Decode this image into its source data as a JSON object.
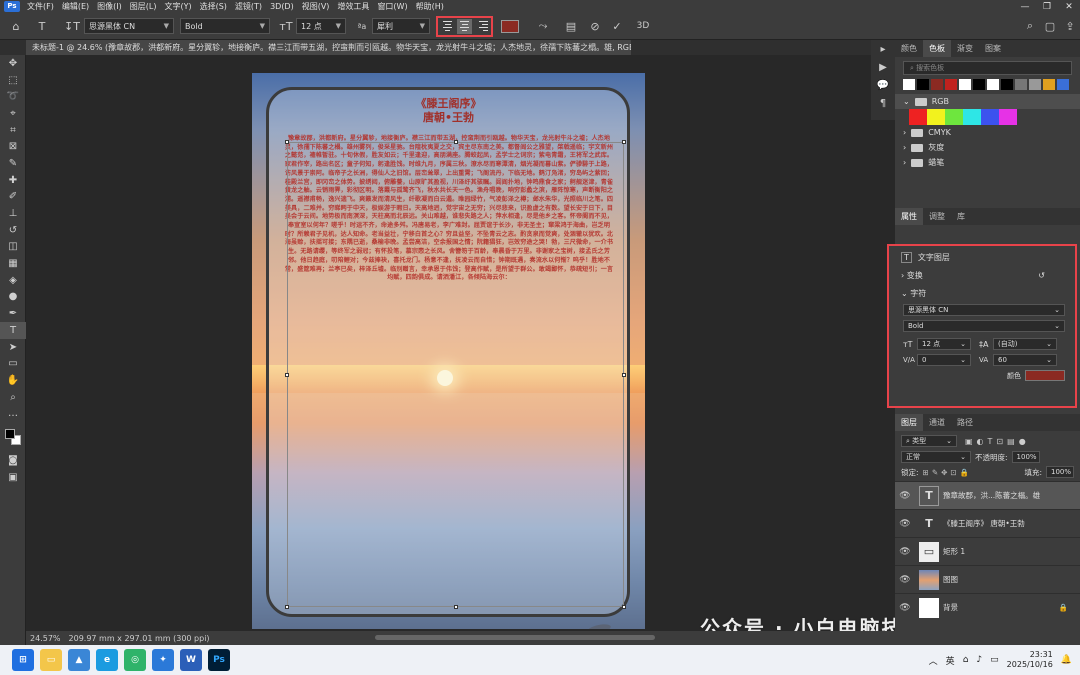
{
  "menu": {
    "items": [
      "文件(F)",
      "编辑(E)",
      "图像(I)",
      "图层(L)",
      "文字(Y)",
      "选择(S)",
      "滤镜(T)",
      "3D(D)",
      "视图(V)",
      "增效工具",
      "窗口(W)",
      "帮助(H)"
    ]
  },
  "options": {
    "font_family": "思源黑体 CN",
    "font_style": "Bold",
    "font_size": "12 点",
    "antialias": "犀利",
    "text_color": "#8b2a22"
  },
  "document": {
    "tab_title": "未标题-1 @ 24.6% (豫章故郡，洪都新府。星分翼轸，地接衡庐。襟三江而带五湖，控蛮荆而引瓯越。物华天宝，龙光射牛斗之墟；人杰地灵，徐孺下陈蕃之榻。雄, RGB/8) *",
    "zoom": "24.57%",
    "size_info": "209.97 mm x 297.01 mm (300 ppi)"
  },
  "poem": {
    "title": "《滕王阁序》",
    "author": "唐朝•王勃",
    "body": "豫章故郡，洪都新府。星分翼轸，地接衡庐。襟三江而带五湖，控蛮荆而引瓯越。物华天宝，龙光射牛斗之墟；人杰地灵，徐孺下陈蕃之榻。雄州雾列，俊采星驰。台隍枕夷夏之交，宾主尽东南之美。都督阎公之雅望，棨戟遥临；宇文新州之懿范，襜帷暂驻。十旬休假，胜友如云；千里逢迎，高朋满座。腾蛟起凤，孟学士之词宗；紫电青霜，王将军之武库。家君作宰，路出名区；童子何知，躬逢胜饯。时维九月，序属三秋。潦水尽而寒潭清，烟光凝而暮山紫。俨骖騑于上路，访风景于崇阿。临帝子之长洲，得仙人之旧馆。层峦耸翠，上出重霄；飞阁流丹，下临无地。鹤汀凫渚，穷岛屿之萦回；桂殿兰宫，即冈峦之体势。披绣闼，俯雕甍，山原旷其盈视，川泽纡其骇瞩。闾阎扑地，钟鸣鼎食之家；舸舰迷津，青雀黄龙之舳。云销雨霁，彩彻区明。落霞与孤鹜齐飞，秋水共长天一色。渔舟唱晚，响穷彭蠡之滨，雁阵惊寒，声断衡阳之浦。遥襟甫畅，逸兴遄飞。爽籁发而清风生，纤歌凝而白云遏。睢园绿竹，气凌彭泽之樽；邺水朱华，光照临川之笔。四美具，二难并。穷睇眄于中天，极娱游于暇日。天高地迥，觉宇宙之无穷；兴尽悲来，识盈虚之有数。望长安于日下，目吴会于云间。地势极而南溟深，天柱高而北辰远。关山难越，谁悲失路之人；萍水相逢，尽是他乡之客。怀帝阍而不见，奉宣室以何年？嗟乎！时运不齐，命途多舛。冯唐易老，李广难封。屈贾谊于长沙，非无圣主；窜梁鸿于海曲，岂乏明时？所赖君子见机，达人知命。老当益壮，宁移白首之心？穷且益坚，不坠青云之志。酌贪泉而觉爽，处涸辙以犹欢。北海虽赊，扶摇可接；东隅已逝，桑榆非晚。孟尝高洁，空余报国之情；阮籍猖狂，岂效穷途之哭！勃，三尺微命，一介书生。无路请缨，等终军之弱冠；有怀投笔，慕宗悫之长风。舍簪笏于百龄，奉晨昏于万里。非谢家之宝树，接孟氏之芳邻。他日趋庭，叨陪鲤对；今兹捧袂，喜托龙门。杨意不逢，抚凌云而自惜；钟期既遇，奏流水以何惭？呜乎！胜地不常，盛筵难再；兰亭已矣，梓泽丘墟。临别赠言，幸承恩于伟饯；登高作赋，是所望于群公。敢竭鄙怀，恭疏短引；一言均赋，四韵俱成。请洒潘江，各倾陆海云尔："
  },
  "panels": {
    "swatch_tabs": [
      "颜色",
      "色板",
      "渐变",
      "图案"
    ],
    "swatch_search": "搜索色板",
    "swatch_colors": [
      "#ffffff",
      "#000000",
      "#8b2a22",
      "#c0221e",
      "#ffffff",
      "#000000",
      "#ffffff",
      "#000000",
      "#777777",
      "#999999",
      "#e0a020",
      "#3a6fd8"
    ],
    "groups": [
      {
        "name": "RGB",
        "colors": [
          "#ee2222",
          "#f2f21e",
          "#6ee63e",
          "#2ee6e6",
          "#3c52ee",
          "#e632e6"
        ]
      },
      {
        "name": "CMYK"
      },
      {
        "name": "灰度"
      },
      {
        "name": "蜡笔"
      }
    ],
    "props_tabs": [
      "属性",
      "调整",
      "库"
    ],
    "props": {
      "layer_type": "文字图层",
      "transform": "变换",
      "character": "字符",
      "font": "思源黑体 CN",
      "style": "Bold",
      "size": "12 点",
      "leading": "(自动)",
      "kerning": "0",
      "tracking": "60",
      "color_label": "颜色",
      "color": "#8b2a22"
    },
    "layer_tabs": [
      "图层",
      "通道",
      "路径"
    ],
    "layer_search": "类型",
    "blend_mode": "正常",
    "opacity_label": "不透明度:",
    "opacity": "100%",
    "lock_label": "锁定:",
    "fill_label": "填充:",
    "fill": "100%",
    "layers": [
      {
        "name": "豫章故郡，洪...陈蕃之榻。雄",
        "thumb": "T"
      },
      {
        "name": "《滕王阁序》 唐朝•王勃",
        "thumb": "T"
      },
      {
        "name": "矩形 1",
        "thumb": "▭"
      },
      {
        "name": "图图",
        "thumb": "▣"
      },
      {
        "name": "背景",
        "thumb": "□"
      }
    ]
  },
  "taskbar": {
    "time": "23:31",
    "date": "2025/10/16",
    "ime": "英",
    "watermark": "公众号 · 小白电脑技术"
  }
}
